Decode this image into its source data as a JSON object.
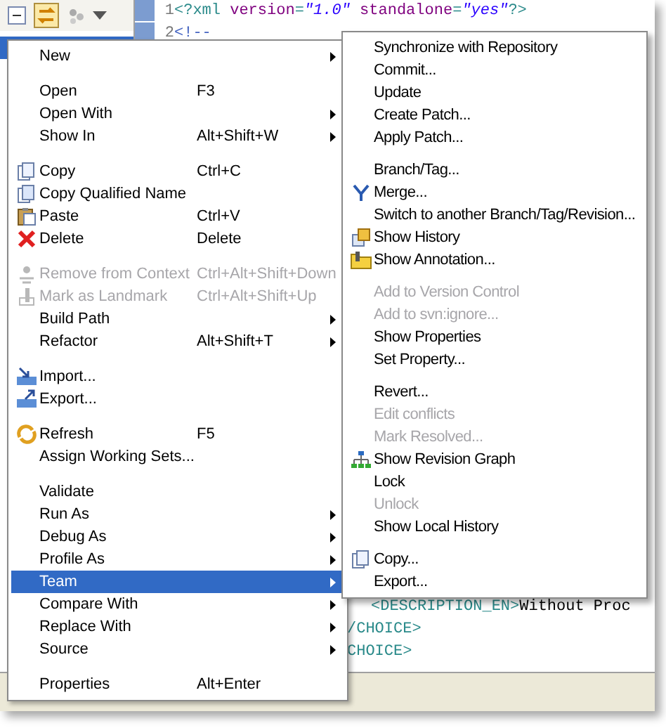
{
  "editor": {
    "top_lines": [
      {
        "number": "1",
        "tokens": [
          {
            "kind": "tag",
            "text": "<?xml "
          },
          {
            "kind": "attr",
            "text": "version"
          },
          {
            "kind": "tag",
            "text": "="
          },
          {
            "kind": "value",
            "text": "\"1.0\""
          },
          {
            "kind": "attr",
            "text": " standalone"
          },
          {
            "kind": "tag",
            "text": "="
          },
          {
            "kind": "value",
            "text": "\"yes\""
          },
          {
            "kind": "tag",
            "text": "?>"
          }
        ]
      },
      {
        "number": "2",
        "tokens": [
          {
            "kind": "comment",
            "text": "<!--"
          }
        ]
      }
    ],
    "bottom_lines": [
      {
        "indent": true,
        "tokens": [
          {
            "kind": "tag",
            "text": "<DESCRIPTION_EN>"
          },
          {
            "kind": "plain",
            "text": "Without Proc"
          }
        ]
      },
      {
        "indent": false,
        "tokens": [
          {
            "kind": "tag",
            "text": "/CHOICE>"
          }
        ]
      },
      {
        "indent": false,
        "tokens": [
          {
            "kind": "tag",
            "text": "CHOICE>"
          }
        ]
      }
    ]
  },
  "context_menu": {
    "groups": [
      [
        {
          "label": "New",
          "submenu": true,
          "disabled": false,
          "selected": false
        }
      ],
      [
        {
          "label": "Open",
          "shortcut": "F3",
          "submenu": false,
          "disabled": false,
          "selected": false
        },
        {
          "label": "Open With",
          "submenu": true,
          "disabled": false,
          "selected": false
        },
        {
          "label": "Show In",
          "shortcut": "Alt+Shift+W",
          "submenu": true,
          "disabled": false,
          "selected": false
        }
      ],
      [
        {
          "label": "Copy",
          "shortcut": "Ctrl+C",
          "submenu": false,
          "disabled": false,
          "selected": false
        },
        {
          "label": "Copy Qualified Name",
          "submenu": false,
          "disabled": false,
          "selected": false
        },
        {
          "label": "Paste",
          "shortcut": "Ctrl+V",
          "submenu": false,
          "disabled": false,
          "selected": false
        },
        {
          "label": "Delete",
          "shortcut": "Delete",
          "submenu": false,
          "disabled": false,
          "selected": false
        }
      ],
      [
        {
          "label": "Remove from Context",
          "shortcut": "Ctrl+Alt+Shift+Down",
          "submenu": false,
          "disabled": true,
          "selected": false
        },
        {
          "label": "Mark as Landmark",
          "shortcut": "Ctrl+Alt+Shift+Up",
          "submenu": false,
          "disabled": true,
          "selected": false
        },
        {
          "label": "Build Path",
          "submenu": true,
          "disabled": false,
          "selected": false
        },
        {
          "label": "Refactor",
          "shortcut": "Alt+Shift+T",
          "submenu": true,
          "disabled": false,
          "selected": false
        }
      ],
      [
        {
          "label": "Import...",
          "submenu": false,
          "disabled": false,
          "selected": false
        },
        {
          "label": "Export...",
          "submenu": false,
          "disabled": false,
          "selected": false
        }
      ],
      [
        {
          "label": "Refresh",
          "shortcut": "F5",
          "submenu": false,
          "disabled": false,
          "selected": false
        },
        {
          "label": "Assign Working Sets...",
          "submenu": false,
          "disabled": false,
          "selected": false
        }
      ],
      [
        {
          "label": "Validate",
          "submenu": false,
          "disabled": false,
          "selected": false
        },
        {
          "label": "Run As",
          "submenu": true,
          "disabled": false,
          "selected": false
        },
        {
          "label": "Debug As",
          "submenu": true,
          "disabled": false,
          "selected": false
        },
        {
          "label": "Profile As",
          "submenu": true,
          "disabled": false,
          "selected": false
        },
        {
          "label": "Team",
          "submenu": true,
          "disabled": false,
          "selected": true
        },
        {
          "label": "Compare With",
          "submenu": true,
          "disabled": false,
          "selected": false
        },
        {
          "label": "Replace With",
          "submenu": true,
          "disabled": false,
          "selected": false
        },
        {
          "label": "Source",
          "submenu": true,
          "disabled": false,
          "selected": false
        }
      ],
      [
        {
          "label": "Properties",
          "shortcut": "Alt+Enter",
          "submenu": false,
          "disabled": false,
          "selected": false
        }
      ]
    ]
  },
  "team_submenu": {
    "groups": [
      [
        {
          "label": "Synchronize with Repository",
          "disabled": false
        },
        {
          "label": "Commit...",
          "disabled": false
        },
        {
          "label": "Update",
          "disabled": false
        },
        {
          "label": "Create Patch...",
          "disabled": false
        },
        {
          "label": "Apply Patch...",
          "disabled": false
        }
      ],
      [
        {
          "label": "Branch/Tag...",
          "disabled": false
        },
        {
          "label": "Merge...",
          "disabled": false
        },
        {
          "label": "Switch to another Branch/Tag/Revision...",
          "disabled": false
        },
        {
          "label": "Show History",
          "disabled": false
        },
        {
          "label": "Show Annotation...",
          "disabled": false
        }
      ],
      [
        {
          "label": "Add to Version Control",
          "disabled": true
        },
        {
          "label": "Add to svn:ignore...",
          "disabled": true
        },
        {
          "label": "Show Properties",
          "disabled": false
        },
        {
          "label": "Set Property...",
          "disabled": false
        }
      ],
      [
        {
          "label": "Revert...",
          "disabled": false
        },
        {
          "label": "Edit conflicts",
          "disabled": true
        },
        {
          "label": "Mark Resolved...",
          "disabled": true
        },
        {
          "label": "Show Revision Graph",
          "disabled": false
        },
        {
          "label": "Lock",
          "disabled": false
        },
        {
          "label": "Unlock",
          "disabled": true
        },
        {
          "label": "Show Local History",
          "disabled": false
        }
      ],
      [
        {
          "label": "Copy...",
          "disabled": false
        },
        {
          "label": "Export...",
          "disabled": false
        }
      ]
    ]
  }
}
